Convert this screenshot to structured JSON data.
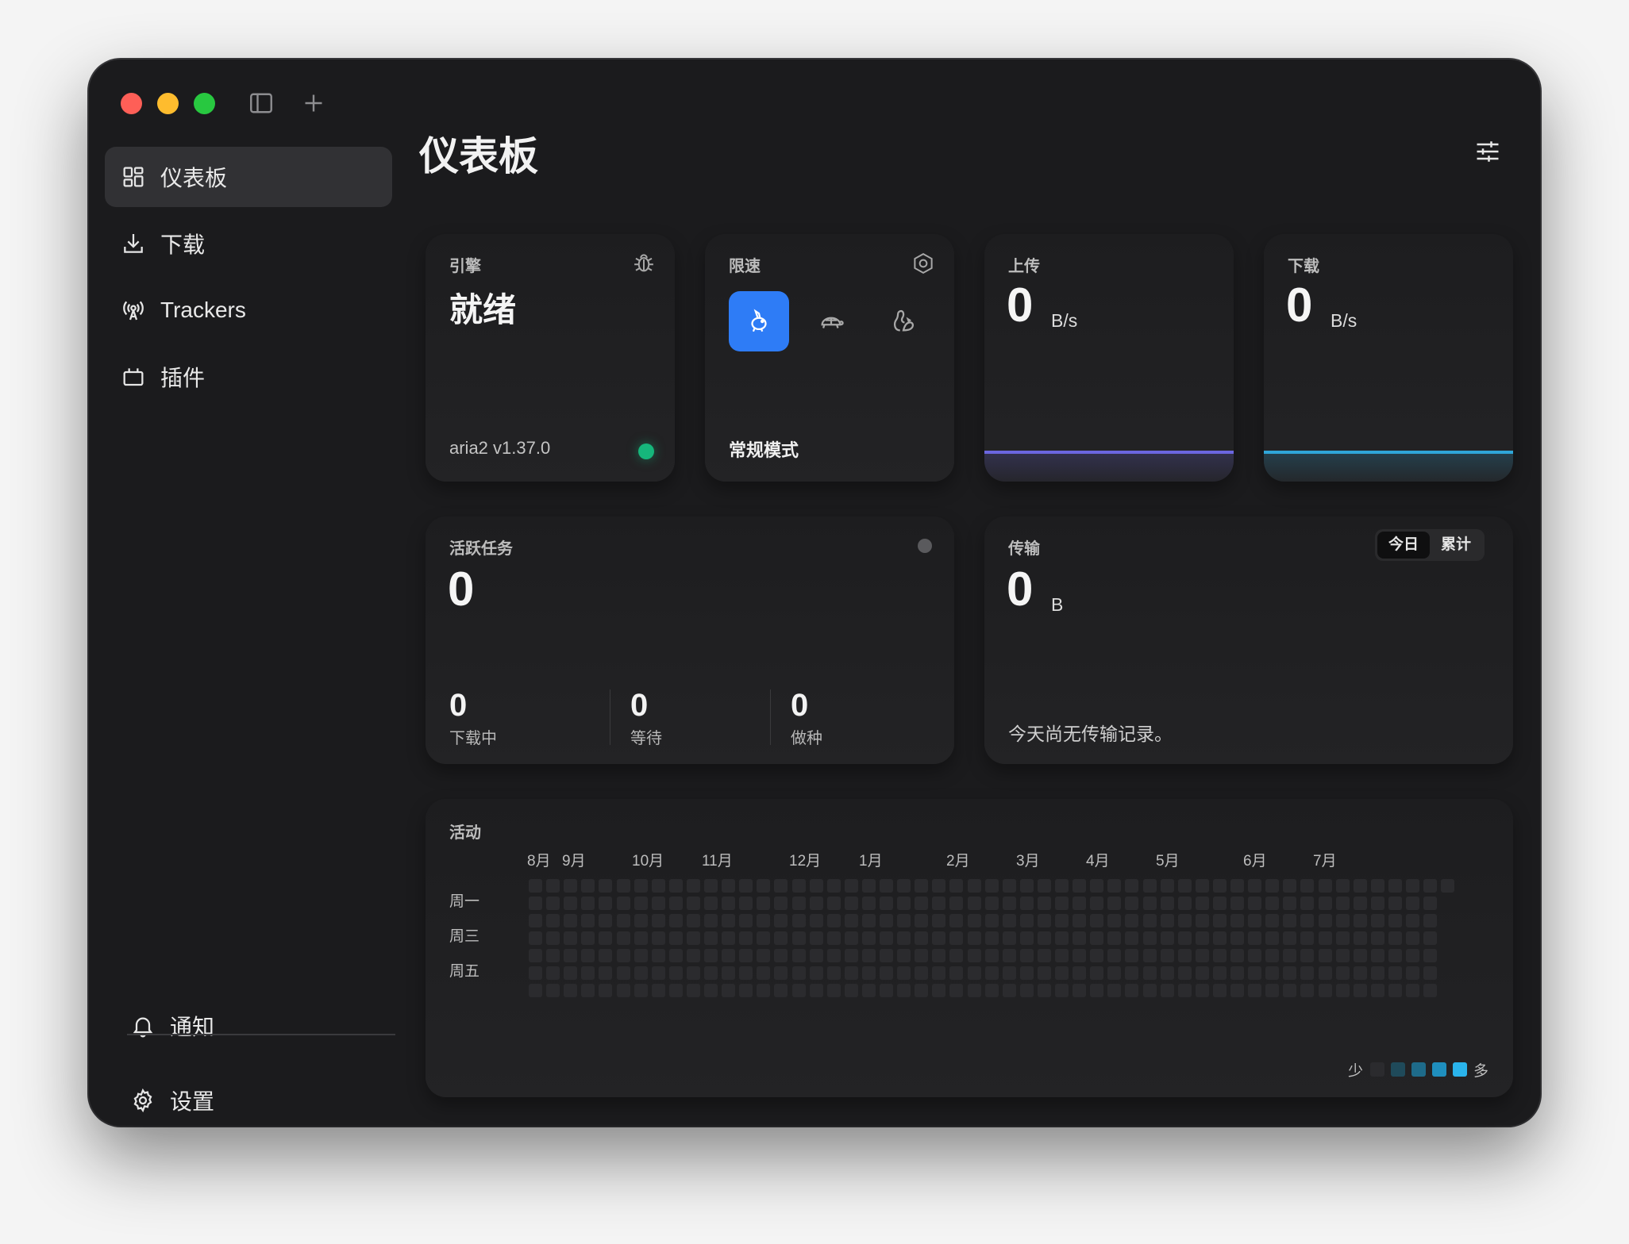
{
  "sidebar": {
    "items": [
      {
        "label": "仪表板",
        "icon": "dashboard-icon",
        "active": true
      },
      {
        "label": "下载",
        "icon": "download-icon",
        "active": false
      },
      {
        "label": "Trackers",
        "icon": "broadcast-icon",
        "active": false
      },
      {
        "label": "插件",
        "icon": "plugin-icon",
        "active": false
      }
    ],
    "notifications_label": "通知",
    "settings_label": "设置"
  },
  "header": {
    "title": "仪表板"
  },
  "engine": {
    "label": "引擎",
    "status": "就绪",
    "version": "aria2 v1.37.0",
    "status_color": "#16b67b"
  },
  "speed_limit": {
    "label": "限速",
    "mode": "常规模式",
    "active_color": "#2e7cf6"
  },
  "upload": {
    "label": "上传",
    "value": "0",
    "unit": "B/s",
    "line_color": "#6b66e0"
  },
  "download": {
    "label": "下载",
    "value": "0",
    "unit": "B/s",
    "line_color": "#2fa6d8"
  },
  "active_tasks": {
    "label": "活跃任务",
    "value": "0",
    "downloading": {
      "value": "0",
      "label": "下载中"
    },
    "waiting": {
      "value": "0",
      "label": "等待"
    },
    "seeding": {
      "value": "0",
      "label": "做种"
    }
  },
  "transfer": {
    "label": "传输",
    "value": "0",
    "unit": "B",
    "tabs": {
      "today": "今日",
      "total": "累计"
    },
    "empty_message": "今天尚无传输记录。"
  },
  "activity": {
    "label": "活动",
    "months": [
      "8月",
      "9月",
      "10月",
      "11月",
      "12月",
      "1月",
      "2月",
      "3月",
      "4月",
      "5月",
      "6月",
      "7月"
    ],
    "days": [
      "周一",
      "周三",
      "周五"
    ],
    "legend_less": "少",
    "legend_more": "多",
    "legend_colors": [
      "#2b2b2e",
      "#1f4a5a",
      "#1e6b8a",
      "#1f8fbe",
      "#2ab4ec"
    ]
  }
}
